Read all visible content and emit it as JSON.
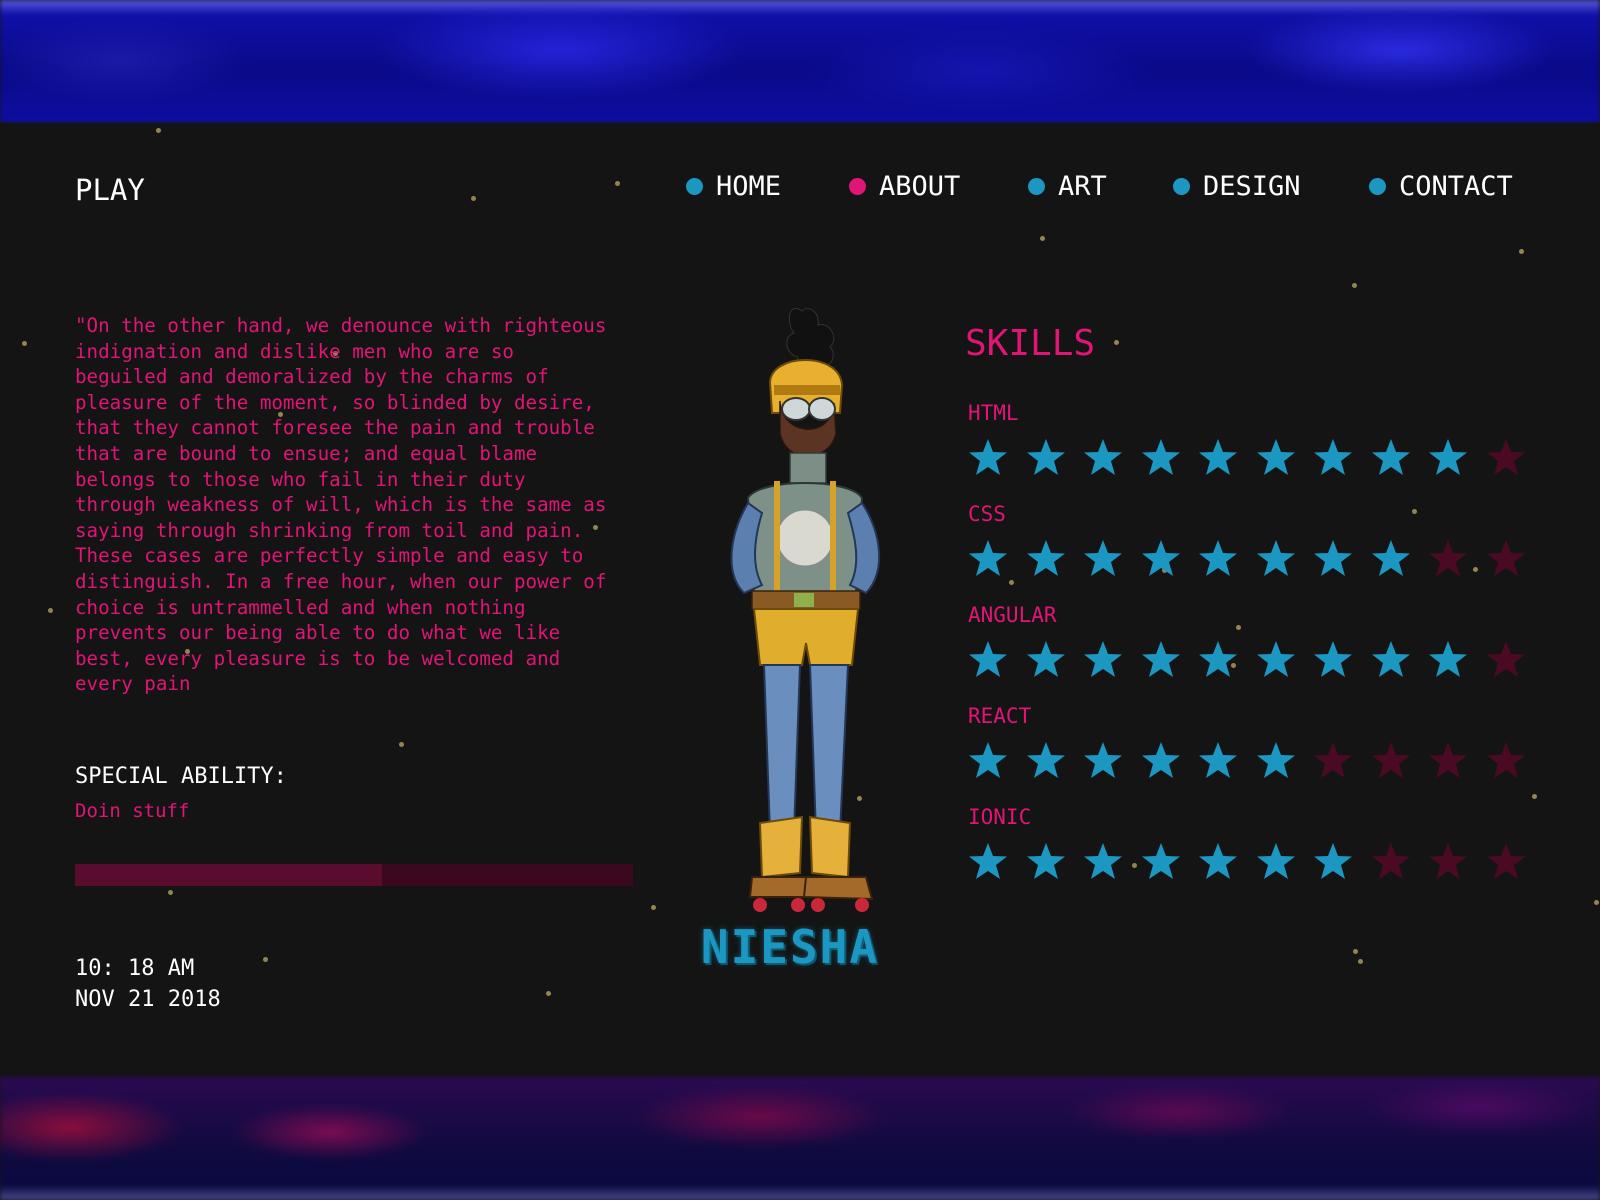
{
  "header": {
    "logo": "PLAY",
    "nav": [
      {
        "label": "HOME",
        "active": false
      },
      {
        "label": "ABOUT",
        "active": true
      },
      {
        "label": "ART",
        "active": false
      },
      {
        "label": "DESIGN",
        "active": false
      },
      {
        "label": "CONTACT",
        "active": false
      }
    ]
  },
  "bio": {
    "quote": "\"On the other hand, we denounce with righteous indignation and dislike men who are so beguiled and demoralized by the charms of pleasure of the moment, so blinded by desire, that they cannot foresee the pain and trouble that are bound to ensue; and equal blame belongs to those who fail in their duty through weakness of will, which is the same as saying through shrinking from toil and pain. These cases are perfectly simple and easy to distinguish. In a free hour, when our power of choice is untrammelled and when nothing prevents our being able to do what we like best, every pleasure is to be welcomed and every pain",
    "ability_title": "SPECIAL ABILITY:",
    "ability_value": "Doin stuff",
    "ability_progress": 0.55
  },
  "clock": {
    "time": "10: 18 AM",
    "date": "NOV 21 2018"
  },
  "character": {
    "name": "NIESHA"
  },
  "skills": {
    "title": "SKILLS",
    "max": 10,
    "items": [
      {
        "name": "HTML",
        "rating": 9
      },
      {
        "name": "CSS",
        "rating": 8
      },
      {
        "name": "ANGULAR",
        "rating": 9
      },
      {
        "name": "REACT",
        "rating": 6
      },
      {
        "name": "IONIC",
        "rating": 7
      }
    ]
  },
  "colors": {
    "accent_pink": "#e01576",
    "accent_blue": "#1b97c2",
    "star_empty": "#4a0a24",
    "background": "#141414"
  }
}
